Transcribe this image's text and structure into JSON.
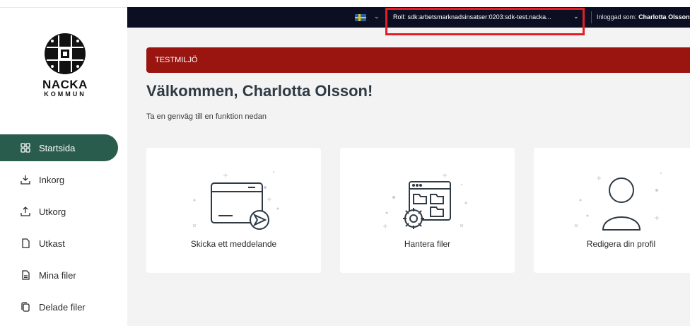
{
  "brand": {
    "name": "NACKA",
    "subname": "KOMMUN"
  },
  "sidebar": {
    "items": [
      {
        "label": "Startsida",
        "icon": "grid-icon",
        "active": true
      },
      {
        "label": "Inkorg",
        "icon": "inbox-download-icon",
        "active": false
      },
      {
        "label": "Utkorg",
        "icon": "outbox-upload-icon",
        "active": false
      },
      {
        "label": "Utkast",
        "icon": "draft-document-icon",
        "active": false
      },
      {
        "label": "Mina filer",
        "icon": "file-icon",
        "active": false
      },
      {
        "label": "Delade filer",
        "icon": "shared-files-icon",
        "active": false
      }
    ]
  },
  "topbar": {
    "language": "sv-flag-icon",
    "role_label": "Roll:",
    "role_value": "sdk:arbetsmarknadsinsatser:0203:sdk-test.nacka...",
    "login_prefix": "Inloggad som:",
    "login_user": "Charlotta Olsson"
  },
  "banner": {
    "text": "TESTMILJÖ"
  },
  "main": {
    "welcome": "Välkommen, Charlotta Olsson!",
    "subtitle": "Ta en genväg till en funktion nedan"
  },
  "cards": [
    {
      "label": "Skicka ett meddelande",
      "icon": "send-message-icon"
    },
    {
      "label": "Hantera filer",
      "icon": "manage-files-icon"
    },
    {
      "label": "Redigera din profil",
      "icon": "user-profile-icon"
    }
  ],
  "colors": {
    "sidebar_active": "#2a5c4d",
    "topbar_bg": "#0c0e22",
    "banner_bg": "#9a1410",
    "highlight_box": "#e21f26",
    "main_bg": "#f3f3f3"
  }
}
